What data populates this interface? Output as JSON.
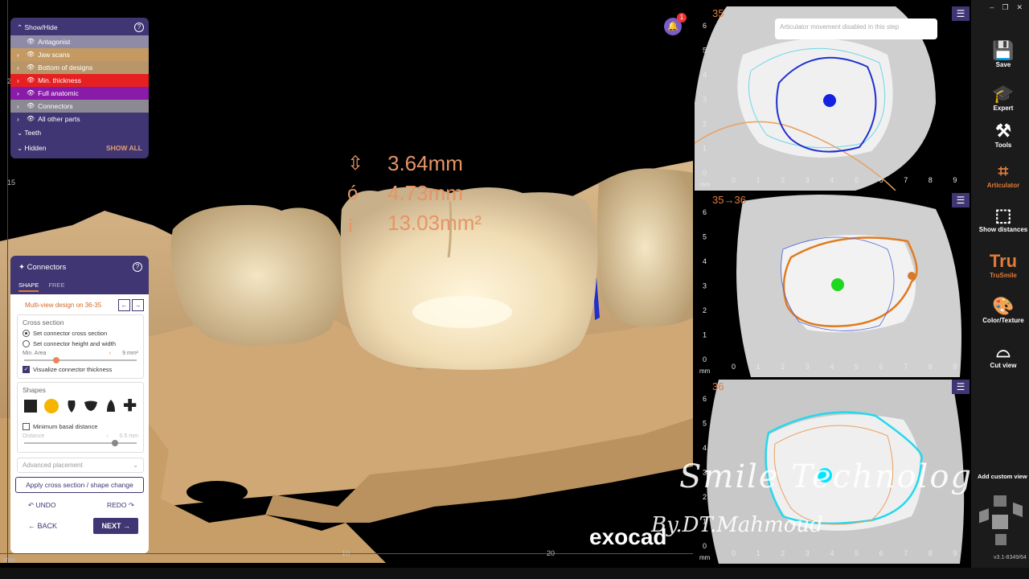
{
  "notifications": {
    "count": "1",
    "icon": "bell-icon"
  },
  "measurements": [
    {
      "symbol": "⇳",
      "value": "3.64mm"
    },
    {
      "symbol": "ó",
      "value": "4.73mm"
    },
    {
      "symbol": "¡",
      "value": "13.03mm²"
    }
  ],
  "ruler": {
    "left_ticks": [
      "2",
      "15"
    ],
    "bottom_ticks": [
      "mm",
      "10",
      "20"
    ]
  },
  "show_hide": {
    "title": "Show/Hide",
    "items": [
      {
        "label": "Antagonist",
        "color": "#8f8aa6"
      },
      {
        "label": "Jaw scans",
        "color": "#c49a62"
      },
      {
        "label": "Bottom of designs",
        "color": "#b8966a"
      },
      {
        "label": "Min. thickness",
        "color": "#e62020"
      },
      {
        "label": "Full anatomic",
        "color": "#8a1aa8"
      },
      {
        "label": "Connectors",
        "color": "#8c8894"
      },
      {
        "label": "All other parts",
        "color": "#3f3673"
      }
    ],
    "teeth": "Teeth",
    "hidden": "Hidden",
    "show_all": "SHOW ALL"
  },
  "connectors": {
    "title": "Connectors",
    "tabs": [
      "SHAPE",
      "FREE"
    ],
    "multi_view": "Multi-view design on 36-35",
    "cross_section": {
      "title": "Cross section",
      "option1": "Set connector cross section",
      "option2": "Set connector height and width",
      "min_area_label": "Min. Area",
      "min_area_value": "9 mm²",
      "min_area_fraction": 0.26,
      "visualize": "Visualize connector thickness"
    },
    "shapes": {
      "title": "Shapes",
      "min_basal": "Minimum basal distance",
      "distance_label": "Distance",
      "distance_value": "0.5 mm",
      "distance_fraction": 0.78
    },
    "advanced": "Advanced placement",
    "apply": "Apply cross section / shape change",
    "undo": "UNDO",
    "redo": "REDO",
    "back": "BACK",
    "next": "NEXT"
  },
  "views": [
    {
      "label": "35",
      "dot_color": "#1520e0"
    },
    {
      "label": "35→36",
      "dot_color": "#1ed81e"
    },
    {
      "label": "36",
      "dot_color": "#00e5ff"
    }
  ],
  "view_axis": {
    "unit": "mm",
    "x_ticks": [
      "0",
      "1",
      "2",
      "3",
      "4",
      "5",
      "6",
      "7",
      "8",
      "9"
    ],
    "y_ticks": [
      "0",
      "1",
      "2",
      "3",
      "4",
      "5",
      "6"
    ]
  },
  "tooltip": "Articulator movement disabled in this step",
  "toolbar": {
    "window_controls": [
      "–",
      "❐",
      "✕"
    ],
    "items": [
      {
        "label": "Save",
        "icon": "save-icon",
        "glyph": "💾"
      },
      {
        "label": "Expert",
        "icon": "graduation-cap-icon",
        "glyph": "🎓"
      },
      {
        "label": "Tools",
        "icon": "tools-icon",
        "glyph": "⚒"
      },
      {
        "label": "Articulator",
        "icon": "articulator-icon",
        "glyph": "⌗"
      },
      {
        "label": "Show distances",
        "icon": "distances-icon",
        "glyph": "⬚"
      },
      {
        "label": "TruSmile",
        "icon": "trusmile-icon",
        "glyph": "Tru"
      },
      {
        "label": "Color/Texture",
        "icon": "palette-icon",
        "glyph": "🎨"
      },
      {
        "label": "Cut view",
        "icon": "cut-view-icon",
        "glyph": "⌓"
      }
    ],
    "add_custom_view": "Add custom view",
    "version": "v3.1-8349/64"
  },
  "watermark": {
    "title": "Smile Technology",
    "byline": "By.DT.Mahmoud",
    "brand": "exocad"
  }
}
